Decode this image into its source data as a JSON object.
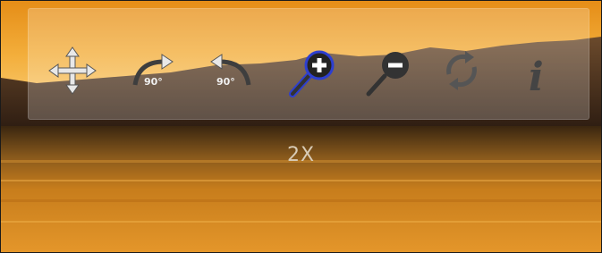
{
  "toolbar": {
    "tools": [
      {
        "icon": "move-icon"
      },
      {
        "icon": "rotate-right-icon",
        "label": "90°"
      },
      {
        "icon": "rotate-left-icon",
        "label": "90°"
      },
      {
        "icon": "zoom-in-icon",
        "active": true
      },
      {
        "icon": "zoom-out-icon"
      },
      {
        "icon": "reset-icon"
      },
      {
        "icon": "info-icon",
        "label": "i"
      }
    ]
  },
  "viewer": {
    "zoom_level": "2X"
  },
  "colors": {
    "sky_top": "#e0901e",
    "sky_glow": "#f7c064",
    "water": "#d8891f",
    "icon_gray": "#3f3f3f",
    "active_ring": "#2d3fd0"
  }
}
